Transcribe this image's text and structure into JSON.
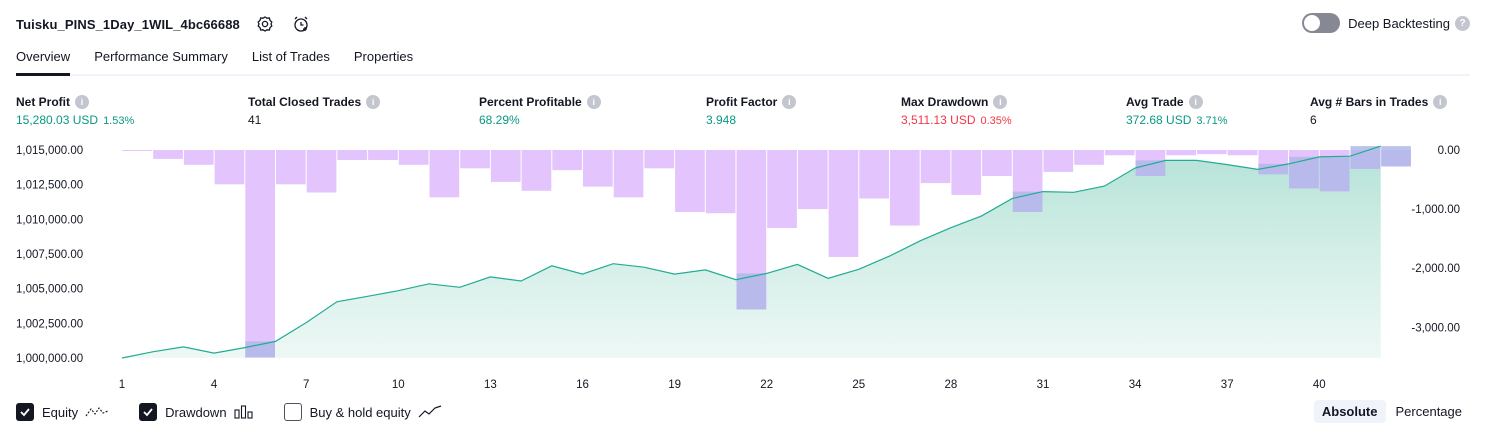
{
  "header": {
    "strategy_name": "Tuisku_PINS_1Day_1WIL_4bc66688",
    "deep_backtesting_label": "Deep Backtesting",
    "help_glyph": "?"
  },
  "tabs": [
    {
      "label": "Overview",
      "active": true
    },
    {
      "label": "Performance Summary",
      "active": false
    },
    {
      "label": "List of Trades",
      "active": false
    },
    {
      "label": "Properties",
      "active": false
    }
  ],
  "metrics": {
    "net_profit": {
      "label": "Net Profit",
      "value": "15,280.03 USD",
      "sub": "1.53%"
    },
    "total_closed_trades": {
      "label": "Total Closed Trades",
      "value": "41"
    },
    "percent_profitable": {
      "label": "Percent Profitable",
      "value": "68.29%"
    },
    "profit_factor": {
      "label": "Profit Factor",
      "value": "3.948"
    },
    "max_drawdown": {
      "label": "Max Drawdown",
      "value": "3,511.13 USD",
      "sub": "0.35%"
    },
    "avg_trade": {
      "label": "Avg Trade",
      "value": "372.68 USD",
      "sub": "3.71%"
    },
    "avg_bars": {
      "label": "Avg # Bars in Trades",
      "value": "6"
    },
    "info_glyph": "i"
  },
  "colors": {
    "positive": "#089981",
    "negative": "#f23645",
    "equity_line": "#22ab94",
    "equity_fill_top": "#b7e4d8",
    "drawdown_bar": "#e1c1fd",
    "overlap": "#b0b8e8"
  },
  "legend": {
    "equity_label": "Equity",
    "equity_checked": true,
    "drawdown_label": "Drawdown",
    "drawdown_checked": true,
    "buyhold_label": "Buy & hold equity",
    "buyhold_checked": false
  },
  "scale": {
    "absolute_label": "Absolute",
    "percentage_label": "Percentage",
    "selected": "Absolute"
  },
  "chart_data": {
    "type": "area",
    "x_ticks": [
      1,
      4,
      7,
      10,
      13,
      16,
      19,
      22,
      25,
      28,
      31,
      34,
      37,
      40
    ],
    "left_axis": {
      "ylim": [
        1000000,
        1015000
      ],
      "ticks": [
        1000000,
        1002500,
        1005000,
        1007500,
        1010000,
        1012500,
        1015000
      ],
      "tick_labels": [
        "1,000,000.00",
        "1,002,500.00",
        "1,005,000.00",
        "1,007,500.00",
        "1,010,000.00",
        "1,012,500.00",
        "1,015,000.00"
      ]
    },
    "right_axis": {
      "ylim": [
        -3520,
        0
      ],
      "ticks": [
        0,
        -1000,
        -2000,
        -3000
      ],
      "tick_labels": [
        "0.00",
        "-1,000.00",
        "-2,000.00",
        "-3,000.00"
      ]
    },
    "series": [
      {
        "name": "Equity",
        "x": [
          1,
          2,
          3,
          4,
          5,
          6,
          7,
          8,
          9,
          10,
          11,
          12,
          13,
          14,
          15,
          16,
          17,
          18,
          19,
          20,
          21,
          22,
          23,
          24,
          25,
          26,
          27,
          28,
          29,
          30,
          31,
          32,
          33,
          34,
          35,
          36,
          37,
          38,
          39,
          40,
          41,
          42
        ],
        "values": [
          1000000,
          1000450,
          1000800,
          1000350,
          1000750,
          1001200,
          1002550,
          1004050,
          1004450,
          1004850,
          1005350,
          1005100,
          1005850,
          1005550,
          1006650,
          1006050,
          1006800,
          1006550,
          1006050,
          1006350,
          1005650,
          1006100,
          1006750,
          1005750,
          1006400,
          1007350,
          1008450,
          1009400,
          1010250,
          1011500,
          1012000,
          1011950,
          1012400,
          1013700,
          1014250,
          1014250,
          1013950,
          1013600,
          1014000,
          1014500,
          1014550,
          1015280
        ]
      },
      {
        "name": "Drawdown",
        "x": [
          1,
          2,
          3,
          4,
          5,
          6,
          7,
          8,
          9,
          10,
          11,
          12,
          13,
          14,
          15,
          16,
          17,
          18,
          19,
          20,
          21,
          22,
          23,
          24,
          25,
          26,
          27,
          28,
          29,
          30,
          31,
          32,
          33,
          34,
          35,
          36,
          37,
          38,
          39,
          40,
          41,
          42
        ],
        "values": [
          -15,
          -150,
          -250,
          -580,
          -3511,
          -580,
          -720,
          -170,
          -170,
          -250,
          -800,
          -310,
          -540,
          -690,
          -340,
          -620,
          -800,
          -310,
          -1050,
          -1070,
          -2700,
          -1320,
          -1000,
          -1810,
          -820,
          -1280,
          -560,
          -760,
          -440,
          -1050,
          -370,
          -250,
          -90,
          -440,
          -90,
          -70,
          -90,
          -410,
          -650,
          -700,
          -320,
          -280
        ]
      }
    ],
    "overlap_note_values": [
      -410,
      -650,
      -700,
      -320,
      -280
    ]
  }
}
